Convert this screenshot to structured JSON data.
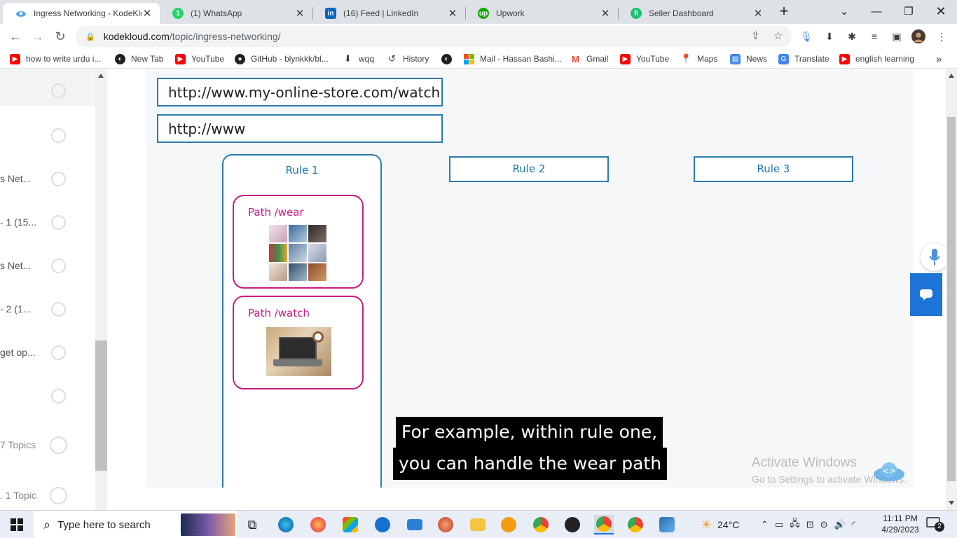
{
  "browser": {
    "tabs": [
      {
        "title": "Ingress Networking - KodeKlo",
        "favicon": "kodekloud-icon",
        "color": "#2a7ab3",
        "active": true
      },
      {
        "title": "(1) WhatsApp",
        "favicon": "whatsapp-icon",
        "color": "#25d366",
        "active": false
      },
      {
        "title": "(16) Feed | LinkedIn",
        "favicon": "linkedin-icon",
        "color": "#0a66c2",
        "active": false
      },
      {
        "title": "Upwork",
        "favicon": "upwork-icon",
        "color": "#14a800",
        "active": false
      },
      {
        "title": "Seller Dashboard",
        "favicon": "fiverr-icon",
        "color": "#1dbf73",
        "active": false
      }
    ],
    "new_tab_label": "+",
    "address": {
      "domain": "kodekloud.com",
      "path": "/topic/ingress-networking/"
    },
    "bookmarks": [
      {
        "label": "how to write urdu i...",
        "icon": "youtube-icon",
        "color": "#ff0000"
      },
      {
        "label": "New Tab",
        "icon": "globe-icon",
        "color": "#202124"
      },
      {
        "label": "YouTube",
        "icon": "youtube-icon",
        "color": "#ff0000"
      },
      {
        "label": "GitHub - blynkkk/bl...",
        "icon": "github-icon",
        "color": "#202124"
      },
      {
        "label": "wqq",
        "icon": "download-icon",
        "color": "#3c4043"
      },
      {
        "label": "History",
        "icon": "history-icon",
        "color": "#3c4043"
      },
      {
        "label": "",
        "icon": "globe-icon",
        "color": "#202124"
      },
      {
        "label": "Mail - Hassan Bashi...",
        "icon": "microsoft-icon",
        "color": "#f25022"
      },
      {
        "label": "Gmail",
        "icon": "gmail-icon",
        "color": "#ea4335"
      },
      {
        "label": "YouTube",
        "icon": "youtube-icon",
        "color": "#ff0000"
      },
      {
        "label": "Maps",
        "icon": "maps-icon",
        "color": "#34a853"
      },
      {
        "label": "News",
        "icon": "news-icon",
        "color": "#4285f4"
      },
      {
        "label": "Translate",
        "icon": "translate-icon",
        "color": "#4285f4"
      },
      {
        "label": "english learning",
        "icon": "youtube-icon",
        "color": "#ff0000"
      }
    ],
    "more_bookmarks": "»"
  },
  "sidebar": {
    "items": [
      {
        "label": ""
      },
      {
        "label": ""
      },
      {
        "label": "s Net..."
      },
      {
        "label": "- 1 (15..."
      },
      {
        "label": "s Net..."
      },
      {
        "label": "- 2 (1..."
      },
      {
        "label": "get op..."
      },
      {
        "label": ""
      },
      {
        "label": "7 Topics"
      },
      {
        "label": ". 1 Topic"
      }
    ]
  },
  "slide": {
    "url_1": "http://www.my-online-store.com/watch",
    "url_2": "http://www",
    "rules": [
      "Rule 1",
      "Rule 2",
      "Rule 3"
    ],
    "path_wear": "Path /wear",
    "path_watch": "Path /watch"
  },
  "captions": {
    "line1": "For example, within rule one,",
    "line2": "you can handle the wear path"
  },
  "watermark": {
    "line1": "Activate Windows",
    "line2": "Go to Settings to activate Windows."
  },
  "taskbar": {
    "search_placeholder": "Type here to search",
    "weather": "24°C",
    "time": "11:11 PM",
    "date": "4/29/2023",
    "notifications": "2"
  }
}
